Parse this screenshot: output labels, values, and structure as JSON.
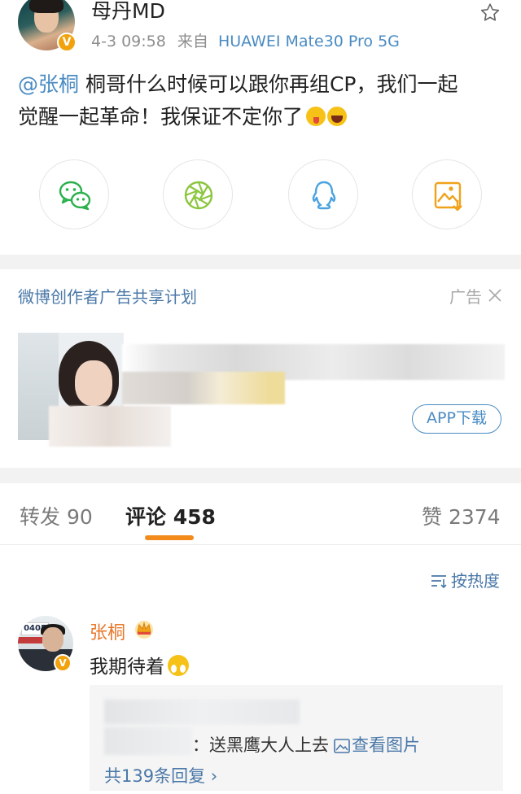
{
  "post": {
    "username": "母丹MD",
    "verified_badge": "V",
    "date": "4-3 09:58",
    "source_prefix": "来自",
    "device": "HUAWEI Mate30 Pro 5G",
    "mention": "@张桐",
    "text_line1": " 桐哥什么时候可以跟你再组CP，我们一起",
    "text_line2": "觉醒一起革命！我保证不定你了",
    "emojis": [
      "tongue-emoji",
      "laugh-emoji"
    ],
    "share_icons": [
      "wechat-icon",
      "moments-icon",
      "qq-icon",
      "save-image-icon"
    ],
    "colors": {
      "link": "#4a8bc2",
      "accent": "#f28a1c"
    }
  },
  "ad": {
    "title": "微博创作者广告共享计划",
    "tag": "广告",
    "button": "APP下载"
  },
  "tabs": {
    "repost": "转发 90",
    "comments": "评论 458",
    "likes": "赞 2374"
  },
  "sort": {
    "label": "按热度"
  },
  "comment": {
    "author": "张桐",
    "verified_badge": "V",
    "avatar_plate": "0405",
    "text": "我期待着",
    "reply_text": "：送黑鹰大人上去",
    "view_image": "查看图片",
    "reply_count": "共139条回复 ›"
  }
}
